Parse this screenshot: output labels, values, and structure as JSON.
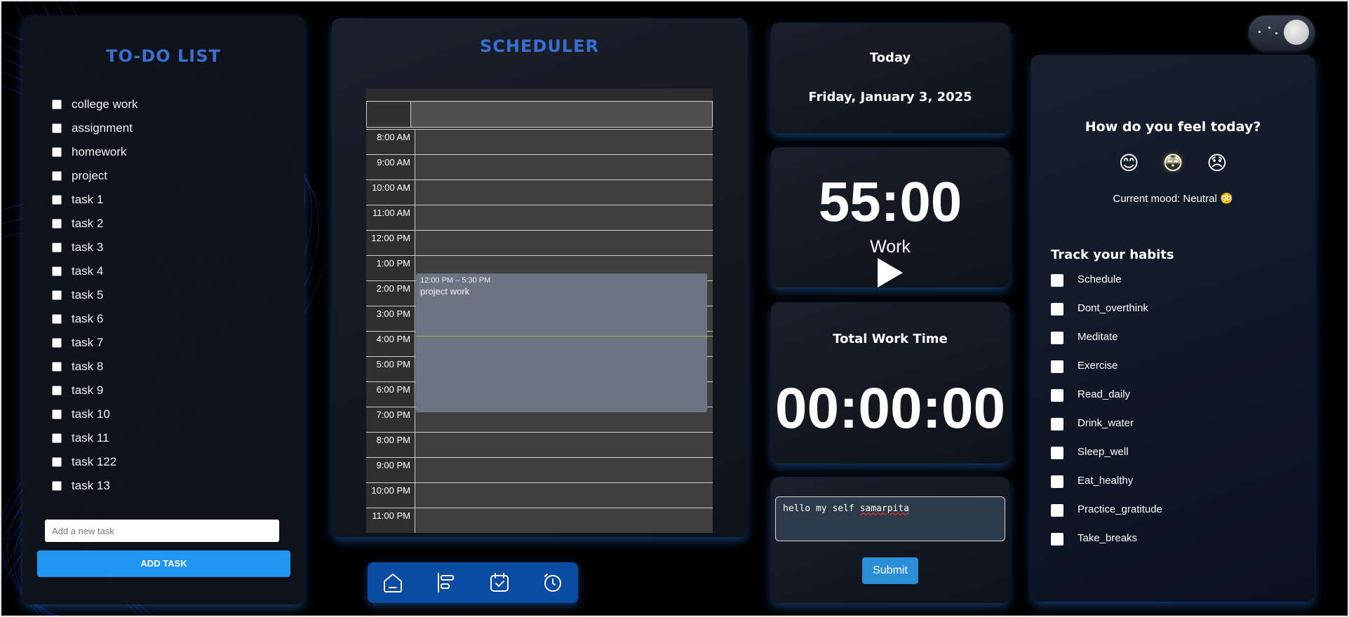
{
  "todo": {
    "title": "TO-DO LIST",
    "items": [
      "college work",
      "assignment",
      "homework",
      "project",
      "task 1",
      "task 2",
      "task 3",
      "task 4",
      "task 5",
      "task 6",
      "task 7",
      "task 8",
      "task 9",
      "task 10",
      "task 11",
      "task 122",
      "task 13"
    ],
    "input_placeholder": "Add a new task",
    "add_label": "ADD TASK"
  },
  "scheduler": {
    "title": "SCHEDULER",
    "times": [
      "8:00 AM",
      "9:00 AM",
      "10:00 AM",
      "11:00 AM",
      "12:00 PM",
      "1:00 PM",
      "2:00 PM",
      "3:00 PM",
      "4:00 PM",
      "5:00 PM",
      "6:00 PM",
      "7:00 PM",
      "8:00 PM",
      "9:00 PM",
      "10:00 PM",
      "11:00 PM"
    ],
    "event": {
      "time": "12:00 PM – 5:30 PM",
      "name": "project work"
    }
  },
  "nav": {
    "icons": [
      "home-icon",
      "timeline-icon",
      "calendar-check-icon",
      "timer-icon"
    ]
  },
  "today": {
    "label": "Today",
    "date": "Friday, January 3, 2025"
  },
  "timer": {
    "value": "55:00",
    "mode": "Work"
  },
  "total": {
    "label": "Total Work Time",
    "value": "00:00:00"
  },
  "note": {
    "text_before": "hello my self ",
    "text_spell": "samarpita",
    "submit_label": "Submit"
  },
  "mood": {
    "question": "How do you feel today?",
    "emojis": [
      "😊",
      "😳",
      "😞"
    ],
    "current": "Current mood: Neutral 😳"
  },
  "habits": {
    "title": "Track your habits",
    "items": [
      "Schedule",
      "Dont_overthink",
      "Meditate",
      "Exercise",
      "Read_daily",
      "Drink_water",
      "Sleep_well",
      "Eat_healthy",
      "Practice_gratitude",
      "Take_breaks"
    ]
  },
  "colors": {
    "accent": "#3a6fd0",
    "button": "#2196f3",
    "nav": "#0a4ba3",
    "glow": "#2878dc"
  }
}
